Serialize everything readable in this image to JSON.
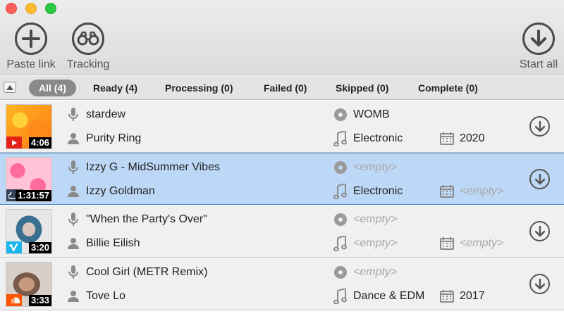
{
  "toolbar": {
    "paste_label": "Paste link",
    "tracking_label": "Tracking",
    "start_label": "Start all"
  },
  "tabs": [
    {
      "label": "All (4)"
    },
    {
      "label": "Ready (4)"
    },
    {
      "label": "Processing (0)"
    },
    {
      "label": "Failed (0)"
    },
    {
      "label": "Skipped (0)"
    },
    {
      "label": "Complete (0)"
    }
  ],
  "tracks": [
    {
      "title": "stardew",
      "artist": "Purity Ring",
      "album": "WOMB",
      "genre": "Electronic",
      "year": "2020",
      "duration": "4:06",
      "source": "youtube"
    },
    {
      "title": "Izzy G - MidSummer Vibes",
      "artist": "Izzy Goldman",
      "album": "<empty>",
      "genre": "Electronic",
      "year": "<empty>",
      "duration": "1:31:57",
      "source": "mixcloud"
    },
    {
      "title": "\"When the Party's Over\"",
      "artist": "Billie Eilish",
      "album": "<empty>",
      "genre": "<empty>",
      "year": "<empty>",
      "duration": "3:20",
      "source": "vimeo"
    },
    {
      "title": "Cool Girl (METR Remix)",
      "artist": "Tove Lo",
      "album": "<empty>",
      "genre": "Dance & EDM",
      "year": "2017",
      "duration": "3:33",
      "source": "soundcloud"
    }
  ],
  "colors": {
    "selected_row": "#bcd8f6",
    "active_tab": "#8a8a8a",
    "youtube": "#e62117",
    "vimeo": "#1ab7ea",
    "soundcloud": "#ff5500",
    "mixcloud": "#314359"
  },
  "icons": [
    "plus-icon",
    "binoculars-icon",
    "download-arrow-icon",
    "microphone-icon",
    "person-icon",
    "disc-icon",
    "music-note-icon",
    "calendar-icon"
  ]
}
